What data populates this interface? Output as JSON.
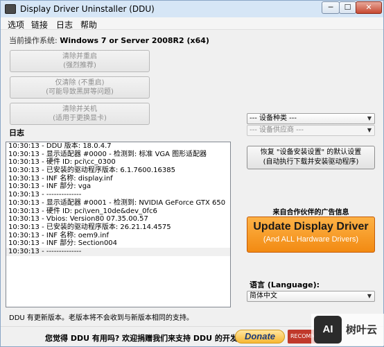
{
  "window": {
    "title": "Display Driver Uninstaller (DDU)",
    "controls": {
      "minimize": "─",
      "maximize": "☐",
      "close": "✕"
    }
  },
  "menu": [
    "选项",
    "链接",
    "日志",
    "帮助"
  ],
  "os": {
    "label": "当前操作系统:",
    "value": "Windows 7 or Server 2008R2 (x64)"
  },
  "buttons": [
    {
      "line1": "清除并重启",
      "line2": "(强烈推荐)"
    },
    {
      "line1": "仅清除 (不重启)",
      "line2": "(可能导致黑屏等问题)"
    },
    {
      "line1": "清除并关机",
      "line2": "(适用于更换显卡)"
    }
  ],
  "log": {
    "heading": "日志",
    "lines": [
      "10:30:13 - DDU 版本: 18.0.4.7",
      "10:30:13 - 显示适配器 #0000 - 检测到: 标准 VGA 图形适配器",
      "10:30:13 - 硬件 ID: pci\\cc_0300",
      "10:30:13 - 已安装的驱动程序版本: 6.1.7600.16385",
      "10:30:13 - INF 名称: display.inf",
      "10:30:13 - INF 部分: vga",
      "10:30:13 - --------------",
      "10:30:13 - 显示适配器 #0001 - 检测到: NVIDIA GeForce GTX 650",
      "10:30:13 - 硬件 ID: pci\\ven_10de&dev_0fc6",
      "10:30:13 - Vbios: Version80 07.35.00.57",
      "10:30:13 - 已安装的驱动程序版本: 26.21.14.4575",
      "10:30:13 - INF 名称: oem9.inf",
      "10:30:13 - INF 部分: Section004",
      "10:30:13 - --------------"
    ]
  },
  "update_note": "DDU 有更新版本。老版本将不会收到与新版本相同的支持。",
  "device_type": {
    "value": "--- 设备种类 ---"
  },
  "device_vendor": {
    "value": "--- 设备供应商 ---"
  },
  "restore": {
    "line1": "恢复 \"设备安装设置\" 的默认设置",
    "line2": "(自动执行下载并安装驱动程序)"
  },
  "ad": {
    "heading": "来自合作伙伴的广告信息",
    "main": "Update Display Driver",
    "sub": "(And ALL Hardware Drivers)"
  },
  "language": {
    "label": "语言 (Language):",
    "value": "简体中文"
  },
  "status": {
    "text": "您觉得 DDU 有用吗? 欢迎捐赠我们来支持 DDU 的开发工作.",
    "donate": "Donate",
    "recommend": "RECOMM"
  },
  "watermark": {
    "logo": "AI",
    "text": "树叶云"
  },
  "icons": {
    "dropdown": "▼"
  }
}
